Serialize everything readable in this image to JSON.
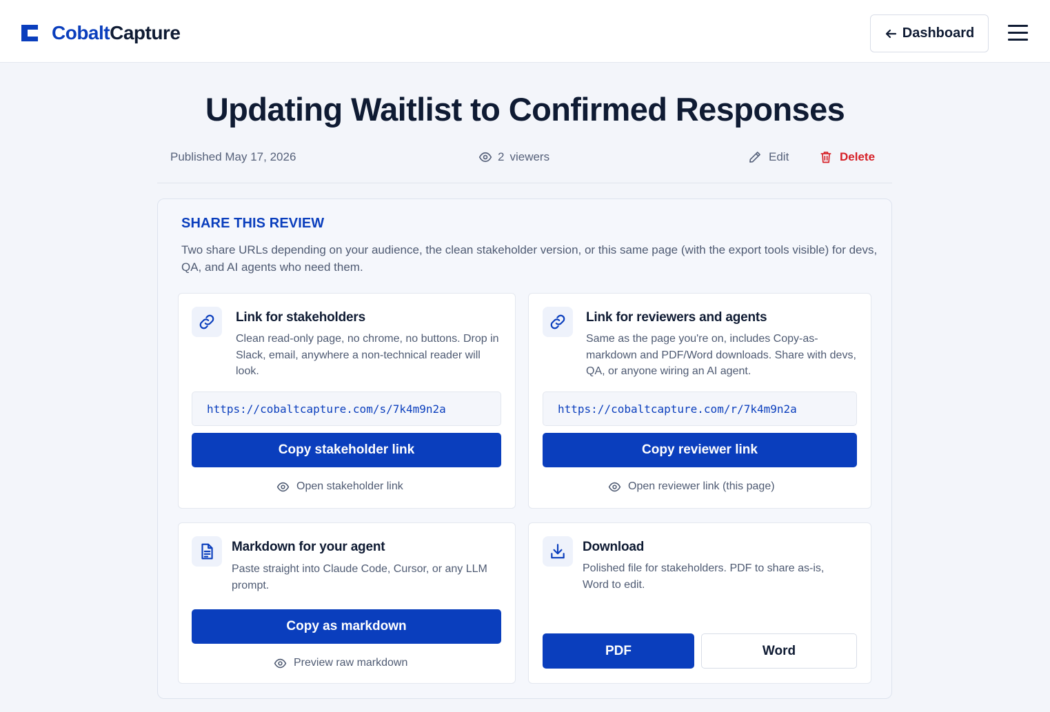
{
  "header": {
    "logo_part1": "Cobalt",
    "logo_part2": "Capture",
    "dashboard_label": "Dashboard"
  },
  "page": {
    "title": "Updating Waitlist to Confirmed Responses",
    "published": "Published May 17, 2026",
    "viewers_count": "2",
    "viewers_label": "viewers",
    "edit_label": "Edit",
    "delete_label": "Delete"
  },
  "share": {
    "heading": "SHARE THIS REVIEW",
    "description": "Two share URLs depending on your audience, the clean stakeholder version, or this same page (with the export tools visible) for devs, QA, and AI agents who need them.",
    "stakeholder": {
      "title": "Link for stakeholders",
      "description": "Clean read-only page, no chrome, no buttons. Drop in Slack, email, anywhere a non-technical reader will look.",
      "url": "https://cobaltcapture.com/s/7k4m9n2a",
      "copy_label": "Copy stakeholder link",
      "open_label": "Open stakeholder link"
    },
    "reviewer": {
      "title": "Link for reviewers and agents",
      "description": "Same as the page you're on, includes Copy-as-markdown and PDF/Word downloads. Share with devs, QA, or anyone wiring an AI agent.",
      "url": "https://cobaltcapture.com/r/7k4m9n2a",
      "copy_label": "Copy reviewer link",
      "open_label": "Open reviewer link (this page)"
    },
    "markdown": {
      "title": "Markdown for your agent",
      "description": "Paste straight into Claude Code, Cursor, or any LLM prompt.",
      "copy_label": "Copy as markdown",
      "preview_label": "Preview raw markdown"
    },
    "download": {
      "title": "Download",
      "description": "Polished file for stakeholders. PDF to share as-is, Word to edit.",
      "pdf_label": "PDF",
      "word_label": "Word"
    }
  },
  "colors": {
    "accent": "#0a3ebd",
    "danger": "#d61f26",
    "text": "#0f1b33",
    "muted": "#4e5a72"
  },
  "icons": [
    "logo-icon",
    "arrow-left-icon",
    "hamburger-icon",
    "eye-icon",
    "pencil-icon",
    "trash-icon",
    "link-icon",
    "document-icon",
    "download-icon"
  ]
}
